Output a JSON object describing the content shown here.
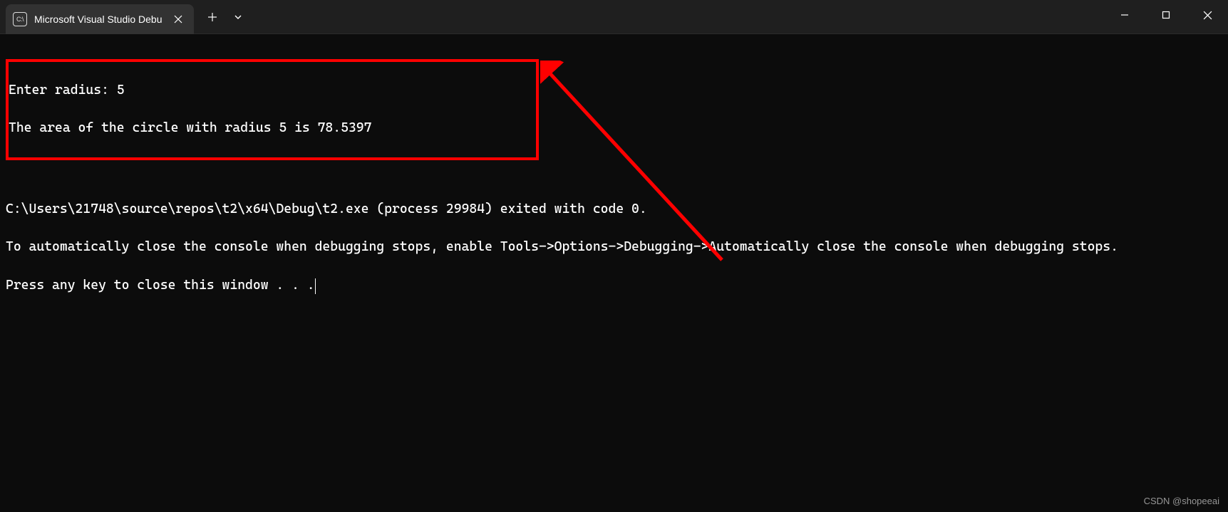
{
  "tab": {
    "title": "Microsoft Visual Studio Debu"
  },
  "terminal": {
    "line1": "Enter radius: 5",
    "line2": "The area of the circle with radius 5 is 78.5397",
    "line3": "C:\\Users\\21748\\source\\repos\\t2\\x64\\Debug\\t2.exe (process 29984) exited with code 0.",
    "line4": "To automatically close the console when debugging stops, enable Tools->Options->Debugging->Automatically close the console when debugging stops.",
    "line5": "Press any key to close this window . . ."
  },
  "watermark": "CSDN @shopeeai"
}
